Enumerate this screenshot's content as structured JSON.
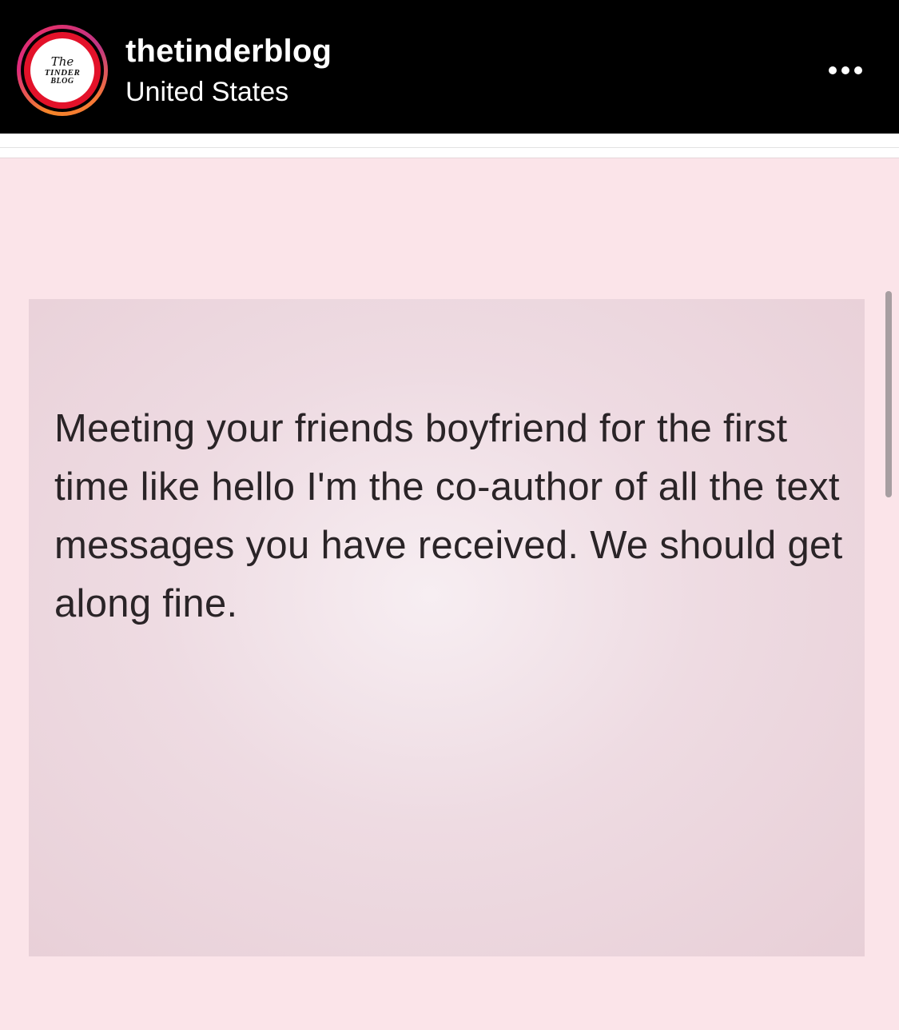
{
  "header": {
    "username": "thetinderblog",
    "location": "United States",
    "avatar_logo": {
      "line1": "The",
      "line2": "TINDER",
      "line3": "BLOG"
    },
    "more_icon": "more-horizontal-icon"
  },
  "post": {
    "text": "Meeting your friends boyfriend for the first time like hello I'm the co-author of all the text messages you have received. We should get along fine."
  },
  "colors": {
    "header_bg": "#000000",
    "post_bg": "#fbe4e9",
    "avatar_red": "#e3122a"
  }
}
